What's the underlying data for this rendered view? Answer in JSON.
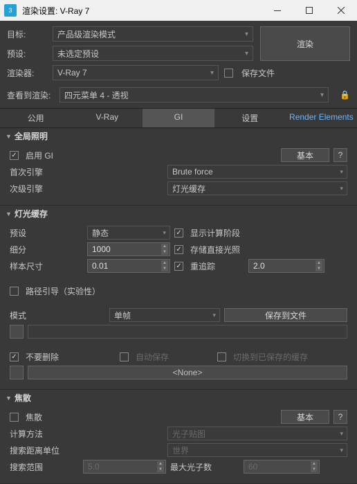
{
  "window": {
    "title": "渲染设置: V-Ray 7",
    "app_badge": "3"
  },
  "top": {
    "target_label": "目标:",
    "target_value": "产品级渲染模式",
    "preset_label": "预设:",
    "preset_value": "未选定预设",
    "renderer_label": "渲染器:",
    "renderer_value": "V-Ray 7",
    "save_file_label": "保存文件",
    "view_label": "查看到渲染:",
    "view_value": "四元菜单 4 - 透视",
    "render_button": "渲染"
  },
  "tabs": [
    "公用",
    "V-Ray",
    "GI",
    "设置",
    "Render Elements"
  ],
  "gi": {
    "section_title": "全局照明",
    "enable_label": "启用 GI",
    "basic_label": "基本",
    "help": "?",
    "primary_label": "首次引擎",
    "primary_value": "Brute force",
    "secondary_label": "次级引擎",
    "secondary_value": "灯光缓存"
  },
  "lc": {
    "section_title": "灯光缓存",
    "preset_label": "预设",
    "preset_value": "静态",
    "show_calc_label": "显示计算阶段",
    "subdiv_label": "细分",
    "subdiv_value": "1000",
    "store_direct_label": "存储直接光照",
    "sample_label": "样本尺寸",
    "sample_value": "0.01",
    "retrace_label": "重追踪",
    "retrace_value": "2.0",
    "path_guide_label": "路径引导（实验性）",
    "mode_label": "模式",
    "mode_value": "单帧",
    "save_file_btn": "保存到文件",
    "dont_delete_label": "不要删除",
    "auto_save_label": "自动保存",
    "switch_saved_label": "切换到已保存的缓存",
    "none_label": "<None>"
  },
  "caustics": {
    "section_title": "焦散",
    "enable_label": "焦散",
    "basic_label": "基本",
    "help": "?",
    "calc_method_label": "计算方法",
    "calc_method_value": "光子贴图",
    "dist_unit_label": "搜索距离单位",
    "dist_unit_value": "世界",
    "search_range_label": "搜索范围",
    "search_range_value": "5.0",
    "max_photons_label": "最大光子数",
    "max_photons_value": "60"
  }
}
